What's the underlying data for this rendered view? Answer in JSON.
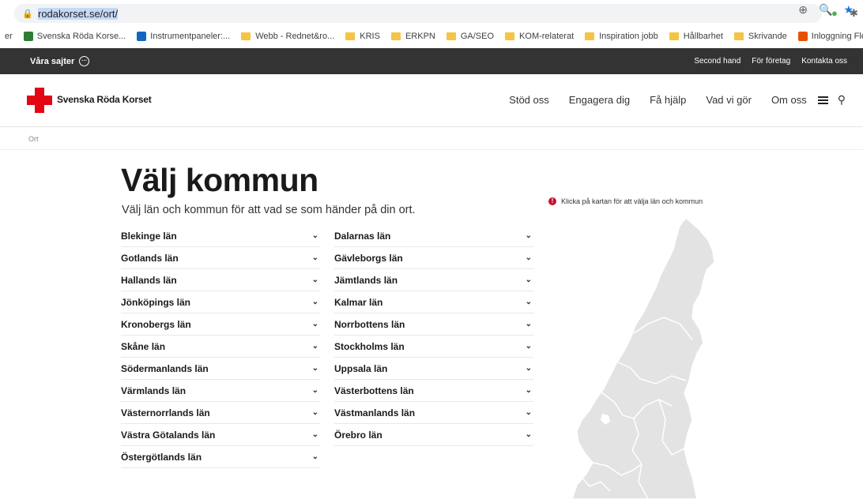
{
  "browser": {
    "url_display": "rodakorset.se/ort/",
    "bookmarks": [
      {
        "label": "er",
        "type": "text"
      },
      {
        "label": "Svenska Röda Korse...",
        "type": "icon"
      },
      {
        "label": "Instrumentpaneler:...",
        "type": "icon"
      },
      {
        "label": "Webb - Rednet&ro...",
        "type": "folder"
      },
      {
        "label": "KRIS",
        "type": "folder"
      },
      {
        "label": "ERKPN",
        "type": "folder"
      },
      {
        "label": "GA/SEO",
        "type": "folder"
      },
      {
        "label": "KOM-relaterat",
        "type": "folder"
      },
      {
        "label": "Inspiration jobb",
        "type": "folder"
      },
      {
        "label": "Hållbarhet",
        "type": "folder"
      },
      {
        "label": "Skrivande",
        "type": "folder"
      },
      {
        "label": "Inloggning Flex HRM",
        "type": "icon"
      }
    ]
  },
  "topbar": {
    "sites_label": "Våra sajter",
    "links": [
      "Second hand",
      "För företag",
      "Kontakta oss"
    ]
  },
  "header": {
    "logo_text": "Svenska Röda Korset",
    "nav": [
      "Stöd oss",
      "Engagera dig",
      "Få hjälp",
      "Vad vi gör",
      "Om oss"
    ]
  },
  "breadcrumb": "Ort",
  "main": {
    "title": "Välj kommun",
    "subtitle": "Välj län och kommun för att vad se som händer på din ort.",
    "left_column": [
      "Blekinge län",
      "Gotlands län",
      "Hallands län",
      "Jönköpings län",
      "Kronobergs län",
      "Skåne län",
      "Södermanlands län",
      "Värmlands län",
      "Västernorrlands län",
      "Västra Götalands län",
      "Östergötlands län"
    ],
    "right_column": [
      "Dalarnas län",
      "Gävleborgs län",
      "Jämtlands län",
      "Kalmar län",
      "Norrbottens län",
      "Stockholms län",
      "Uppsala län",
      "Västerbottens län",
      "Västmanlands län",
      "Örebro län"
    ],
    "map_hint": "Klicka på kartan för att välja län och kommun"
  },
  "colors": {
    "brand_red": "#e30613",
    "topbar_bg": "#333333",
    "map_fill": "#e3e3e3"
  }
}
